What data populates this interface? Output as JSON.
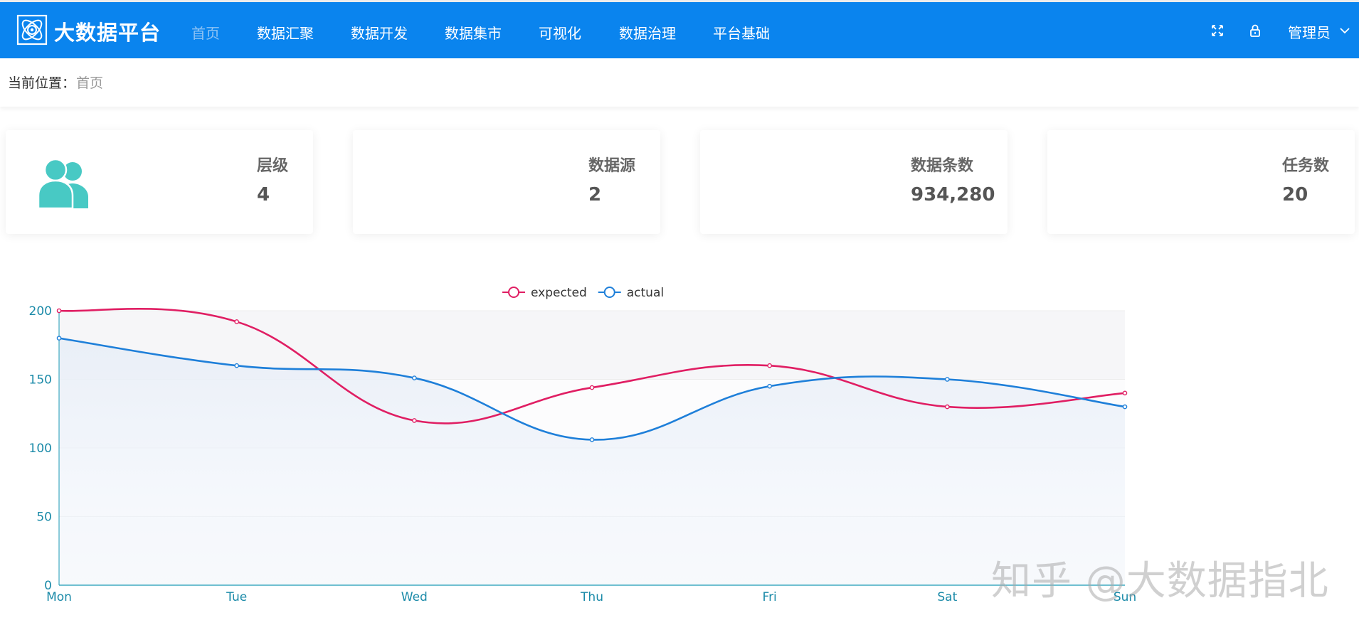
{
  "header": {
    "brand": "大数据平台",
    "nav": [
      "首页",
      "数据汇聚",
      "数据开发",
      "数据集市",
      "可视化",
      "数据治理",
      "平台基础"
    ],
    "active_index": 0,
    "user": "管理员"
  },
  "breadcrumb": {
    "label": "当前位置：",
    "current": "首页"
  },
  "cards": [
    {
      "label": "层级",
      "value": "4"
    },
    {
      "label": "数据源",
      "value": "2"
    },
    {
      "label": "数据条数",
      "value": "934,280"
    },
    {
      "label": "任务数",
      "value": "20"
    }
  ],
  "chart_data": {
    "type": "line",
    "smooth": true,
    "categories": [
      "Mon",
      "Tue",
      "Wed",
      "Thu",
      "Fri",
      "Sat",
      "Sun"
    ],
    "series": [
      {
        "name": "expected",
        "values": [
          200,
          192,
          120,
          144,
          160,
          130,
          140
        ],
        "color": "#e01e63"
      },
      {
        "name": "actual",
        "values": [
          180,
          160,
          151,
          106,
          145,
          150,
          130
        ],
        "color": "#1e7fd9"
      }
    ],
    "yticks": [
      0,
      50,
      100,
      150,
      200
    ],
    "ylim": [
      0,
      200
    ],
    "legend_position": "top-center",
    "axis_color": "#1a9ab5"
  },
  "watermark": "知乎 @大数据指北"
}
